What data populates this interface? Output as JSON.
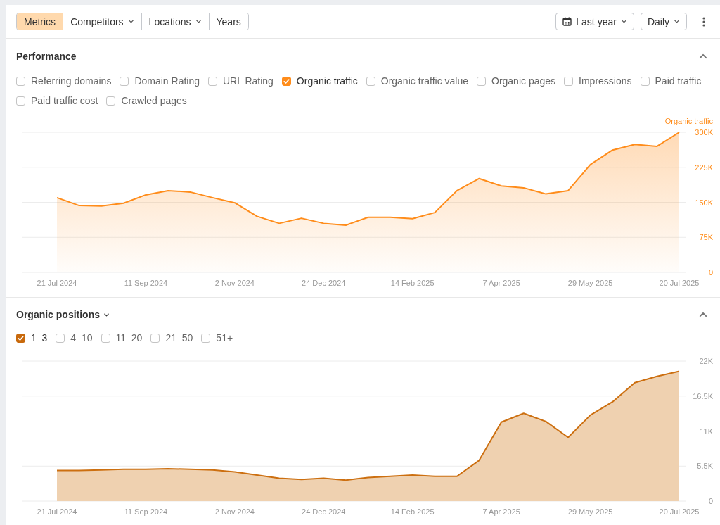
{
  "toolbar": {
    "segments": [
      {
        "label": "Metrics",
        "selected": true,
        "dropdown": false
      },
      {
        "label": "Competitors",
        "selected": false,
        "dropdown": true
      },
      {
        "label": "Locations",
        "selected": false,
        "dropdown": true
      },
      {
        "label": "Years",
        "selected": false,
        "dropdown": false
      }
    ],
    "date_range": "Last year",
    "interval": "Daily"
  },
  "performance": {
    "title": "Performance",
    "expanded": true,
    "metrics": [
      {
        "label": "Referring domains",
        "checked": false
      },
      {
        "label": "Domain Rating",
        "checked": false
      },
      {
        "label": "URL Rating",
        "checked": false
      },
      {
        "label": "Organic traffic",
        "checked": true
      },
      {
        "label": "Organic traffic value",
        "checked": false
      },
      {
        "label": "Organic pages",
        "checked": false
      },
      {
        "label": "Impressions",
        "checked": false
      },
      {
        "label": "Paid traffic",
        "checked": false
      },
      {
        "label": "Paid traffic cost",
        "checked": false
      },
      {
        "label": "Crawled pages",
        "checked": false
      }
    ],
    "chart_data": {
      "type": "area",
      "categories": [
        "21 Jul 2024",
        null,
        null,
        null,
        "11 Sep 2024",
        null,
        null,
        null,
        "2 Nov 2024",
        null,
        null,
        null,
        "24 Dec 2024",
        null,
        null,
        null,
        "14 Feb 2025",
        null,
        null,
        null,
        "7 Apr 2025",
        null,
        null,
        null,
        "29 May 2025",
        null,
        null,
        null,
        "20 Jul 2025"
      ],
      "series": [
        {
          "name": "Organic traffic",
          "color": "#ff8c1a",
          "values": [
            160000,
            143000,
            142000,
            148000,
            166000,
            175000,
            172000,
            160000,
            149000,
            120000,
            105000,
            116000,
            105000,
            101000,
            118000,
            118000,
            115000,
            128000,
            175000,
            201000,
            185000,
            181000,
            168000,
            175000,
            231000,
            262000,
            274000,
            270000,
            300000
          ]
        }
      ],
      "ylim": [
        0,
        300000
      ],
      "grid": true,
      "yticks": [
        {
          "value": 0,
          "label": "0"
        },
        {
          "value": 75000,
          "label": "75K"
        },
        {
          "value": 150000,
          "label": "150K"
        },
        {
          "value": 225000,
          "label": "225K"
        },
        {
          "value": 300000,
          "label": "300K"
        }
      ]
    }
  },
  "organic_positions": {
    "title": "Organic positions",
    "expanded": true,
    "ranges": [
      {
        "label": "1–3",
        "checked": true
      },
      {
        "label": "4–10",
        "checked": false
      },
      {
        "label": "11–20",
        "checked": false
      },
      {
        "label": "21–50",
        "checked": false
      },
      {
        "label": "51+",
        "checked": false
      }
    ],
    "chart_data": {
      "type": "area",
      "categories": [
        "21 Jul 2024",
        null,
        null,
        null,
        "11 Sep 2024",
        null,
        null,
        null,
        "2 Nov 2024",
        null,
        null,
        null,
        "24 Dec 2024",
        null,
        null,
        null,
        "14 Feb 2025",
        null,
        null,
        null,
        "7 Apr 2025",
        null,
        null,
        null,
        "29 May 2025",
        null,
        null,
        null,
        "20 Jul 2025"
      ],
      "values": [
        4800,
        4800,
        4900,
        5000,
        5000,
        5100,
        5000,
        4900,
        4600,
        4100,
        3600,
        3400,
        3600,
        3300,
        3700,
        3900,
        4100,
        3900,
        3900,
        6400,
        12400,
        13800,
        12500,
        10000,
        13500,
        15600,
        18600,
        19600,
        20400
      ],
      "ylim": [
        0,
        22000
      ],
      "grid": true,
      "yticks": [
        {
          "value": 0,
          "label": "0"
        },
        {
          "value": 5500,
          "label": "5.5K"
        },
        {
          "value": 11000,
          "label": "11K"
        },
        {
          "value": 16500,
          "label": "16.5K"
        },
        {
          "value": 22000,
          "label": "22K"
        }
      ]
    }
  }
}
